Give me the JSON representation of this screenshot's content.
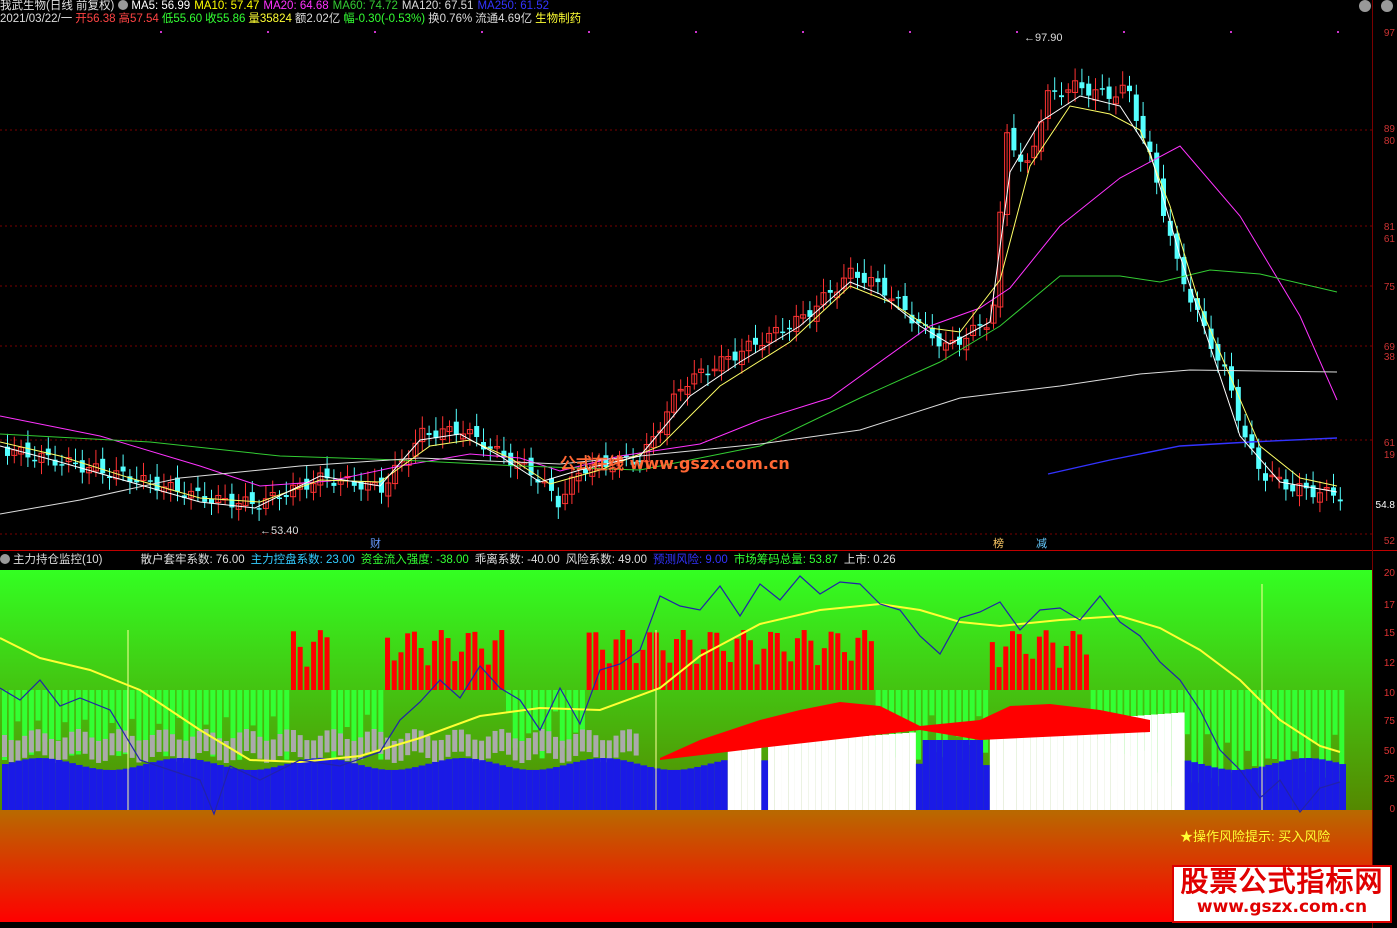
{
  "header": {
    "stock": "我武生物(日线 前复权)",
    "ma": [
      {
        "label": "MA5: 56.99",
        "color": "#ffffff"
      },
      {
        "label": "MA10: 57.47",
        "color": "#ffff00"
      },
      {
        "label": "MA20: 64.68",
        "color": "#ff33ff"
      },
      {
        "label": "MA60: 74.72",
        "color": "#33cc33"
      },
      {
        "label": "MA120: 67.51",
        "color": "#dddddd"
      },
      {
        "label": "MA250: 61.52",
        "color": "#3333ff"
      }
    ],
    "quote": [
      {
        "label": "2021/03/22/一",
        "color": "#dddddd"
      },
      {
        "label": "开56.38",
        "color": "#ff4444"
      },
      {
        "label": "高57.54",
        "color": "#ff4444"
      },
      {
        "label": "低55.60",
        "color": "#33ff33"
      },
      {
        "label": "收55.86",
        "color": "#33ff33"
      },
      {
        "label": "量35824",
        "color": "#ffff33"
      },
      {
        "label": "额2.02亿",
        "color": "#dddddd"
      },
      {
        "label": "幅-0.30(-0.53%)",
        "color": "#33ff33"
      },
      {
        "label": "换0.76%",
        "color": "#dddddd"
      },
      {
        "label": "流通4.69亿",
        "color": "#dddddd"
      },
      {
        "label": "生物制药",
        "color": "#ffff33"
      }
    ]
  },
  "main_chart": {
    "price_labels": {
      "high": "97.90",
      "low": "53.40"
    },
    "watermark": "公式在线 www.gszx.com.cn",
    "markers": [
      {
        "label": "财",
        "color": "#6699ff"
      },
      {
        "label": "榜",
        "color": "#ffcc66"
      },
      {
        "label": "减",
        "color": "#66ccff"
      }
    ],
    "right_labels": [
      {
        "label": "97",
        "color": "#cc3333"
      },
      {
        "label": "89",
        "color": "#cc3333"
      },
      {
        "label": "80",
        "color": "#cc3333"
      },
      {
        "label": "81",
        "color": "#cc3333"
      },
      {
        "label": "61",
        "color": "#cc3333"
      },
      {
        "label": "75",
        "color": "#cc3333"
      },
      {
        "label": "69",
        "color": "#cc3333"
      },
      {
        "label": "38",
        "color": "#cc3333"
      },
      {
        "label": "61",
        "color": "#cc3333"
      },
      {
        "label": "19",
        "color": "#cc3333"
      },
      {
        "label": "54.8",
        "color": "#ffffff"
      },
      {
        "label": "52",
        "color": "#cc3333"
      }
    ]
  },
  "indicator": {
    "title": "主力持仓监控(10)",
    "fields": [
      {
        "label": "散户套牢系数: 76.00",
        "color": "#dddddd"
      },
      {
        "label": "主力控盘系数: 23.00",
        "color": "#33ccff"
      },
      {
        "label": "资金流入强度: -38.00",
        "color": "#33ff33"
      },
      {
        "label": "乖离系数: -40.00",
        "color": "#dddddd"
      },
      {
        "label": "风险系数: 49.00",
        "color": "#dddddd"
      },
      {
        "label": "预测风险: 9.00",
        "color": "#3333ff"
      },
      {
        "label": "市场筹码总量: 53.87",
        "color": "#33ff33"
      },
      {
        "label": "上市: 0.26",
        "color": "#dddddd"
      }
    ],
    "risk_tip": "★操作风险提示: 买入风险",
    "right_labels": [
      "20",
      "17",
      "15",
      "12",
      "10",
      "75",
      "50",
      "25",
      "0"
    ]
  },
  "brand": {
    "title": "股票公式指标网",
    "url": "www.gszx.com.cn"
  },
  "colors": {
    "up": "#ff3333",
    "down": "#54ffff",
    "bg": "#000000",
    "grid": "#7a0000"
  }
}
